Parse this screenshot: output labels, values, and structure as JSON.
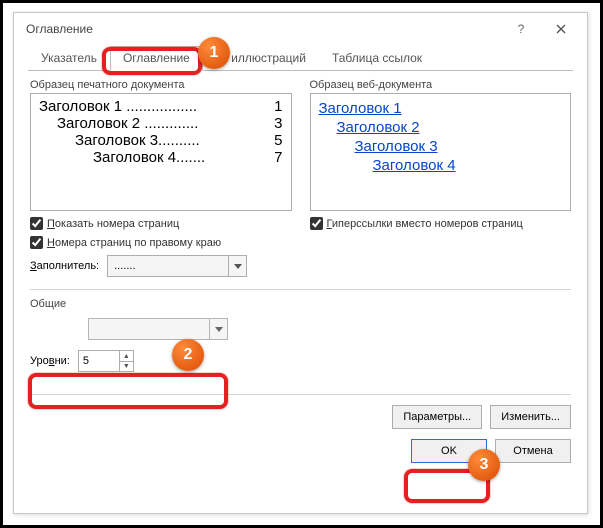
{
  "window": {
    "title": "Оглавление"
  },
  "tabs": {
    "t0": "Указатель",
    "t1": "Оглавление",
    "t2": "ок иллюстраций",
    "t3": "Таблица ссылок"
  },
  "print": {
    "label": "Образец печатного документа",
    "l1a": "Заголовок 1 ",
    "l1b": ".................",
    "l1p": " 1",
    "l2a": "Заголовок 2 ",
    "l2b": ".............",
    "l2p": " 3",
    "l3a": "Заголовок 3",
    "l3b": "..........",
    "l3p": " 5",
    "l4a": "Заголовок 4",
    "l4b": ".......",
    "l4p": " 7"
  },
  "web": {
    "label": "Образец веб-документа",
    "w1": "Заголовок 1",
    "w2": "Заголовок 2",
    "w3": "Заголовок 3",
    "w4": "Заголовок 4"
  },
  "options": {
    "showPages": "Показать номера страниц",
    "rightAlign": "Номера страниц по правому краю",
    "hyperlinks": "Гиперссылки вместо номеров страниц",
    "fillLabel": "Заполнитель:",
    "fillValue": "......."
  },
  "general": {
    "label": "Общие",
    "levelsLabel": "Уровни:",
    "levelsValue": "5"
  },
  "buttons": {
    "params": "Параметры...",
    "modify": "Изменить...",
    "ok": "OK",
    "cancel": "Отмена"
  },
  "badges": {
    "b1": "1",
    "b2": "2",
    "b3": "3"
  }
}
